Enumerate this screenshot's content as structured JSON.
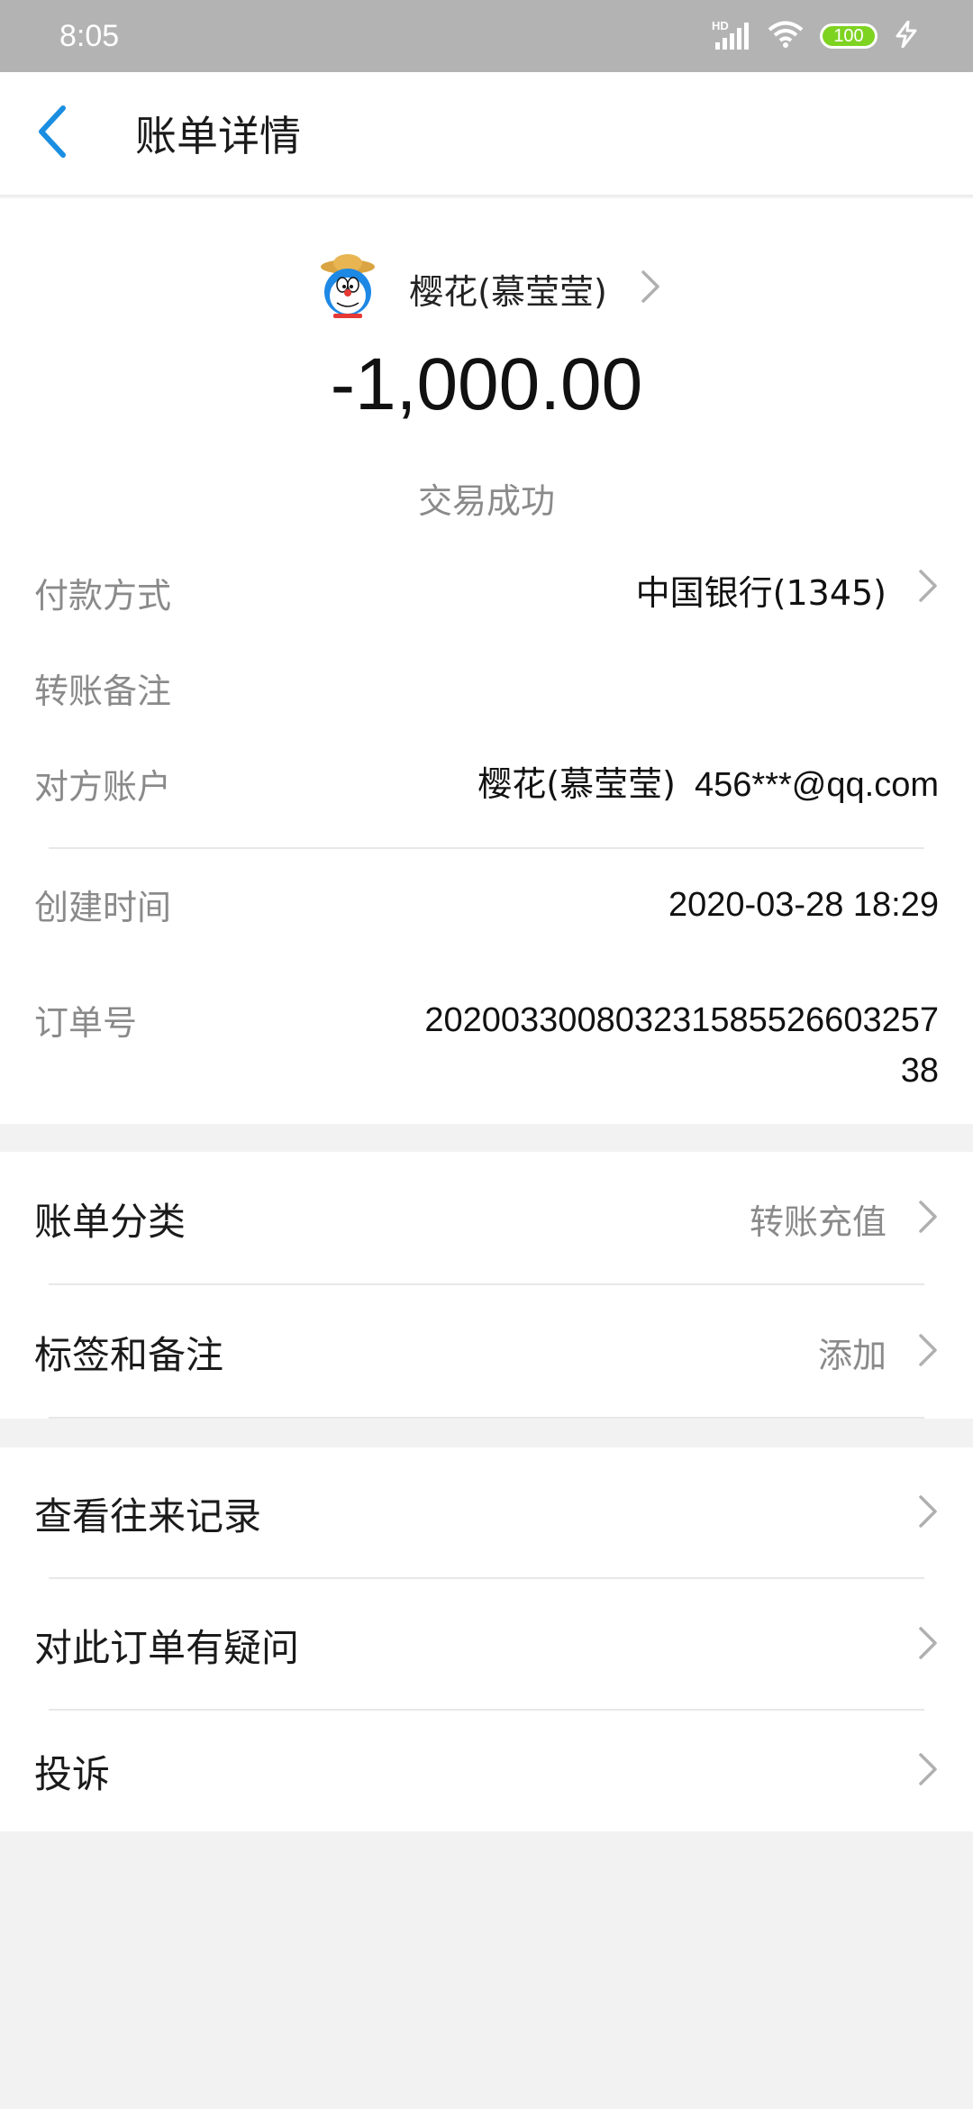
{
  "status_bar": {
    "time": "8:05",
    "battery": "100",
    "network_badge": "HD"
  },
  "nav": {
    "title": "账单详情",
    "back_icon": "chevron-left-icon"
  },
  "payee": {
    "name": "樱花(慕莹莹)",
    "avatar_icon": "doraemon-avatar-icon"
  },
  "amount": "-1,000.00",
  "status_text": "交易成功",
  "details": {
    "payment_method_label": "付款方式",
    "payment_method_value": "中国银行(1345)",
    "transfer_note_label": "转账备注",
    "counterparty_label": "对方账户",
    "counterparty_name": "樱花(慕莹莹)",
    "counterparty_email": "456***@qq.com",
    "created_label": "创建时间",
    "created_value": "2020-03-28 18:29",
    "order_label": "订单号",
    "order_line1": "202003300803231585526603257",
    "order_line2": "38"
  },
  "group1": {
    "category_label": "账单分类",
    "category_value": "转账充值",
    "tags_label": "标签和备注",
    "tags_value": "添加"
  },
  "group2": {
    "history_label": "查看往来记录",
    "question_label": "对此订单有疑问",
    "complaint_label": "投诉"
  },
  "colors": {
    "accent": "#1a8ee1",
    "status_bar": "#b3b3b3",
    "battery": "#7ed321",
    "background": "#f2f2f2"
  }
}
